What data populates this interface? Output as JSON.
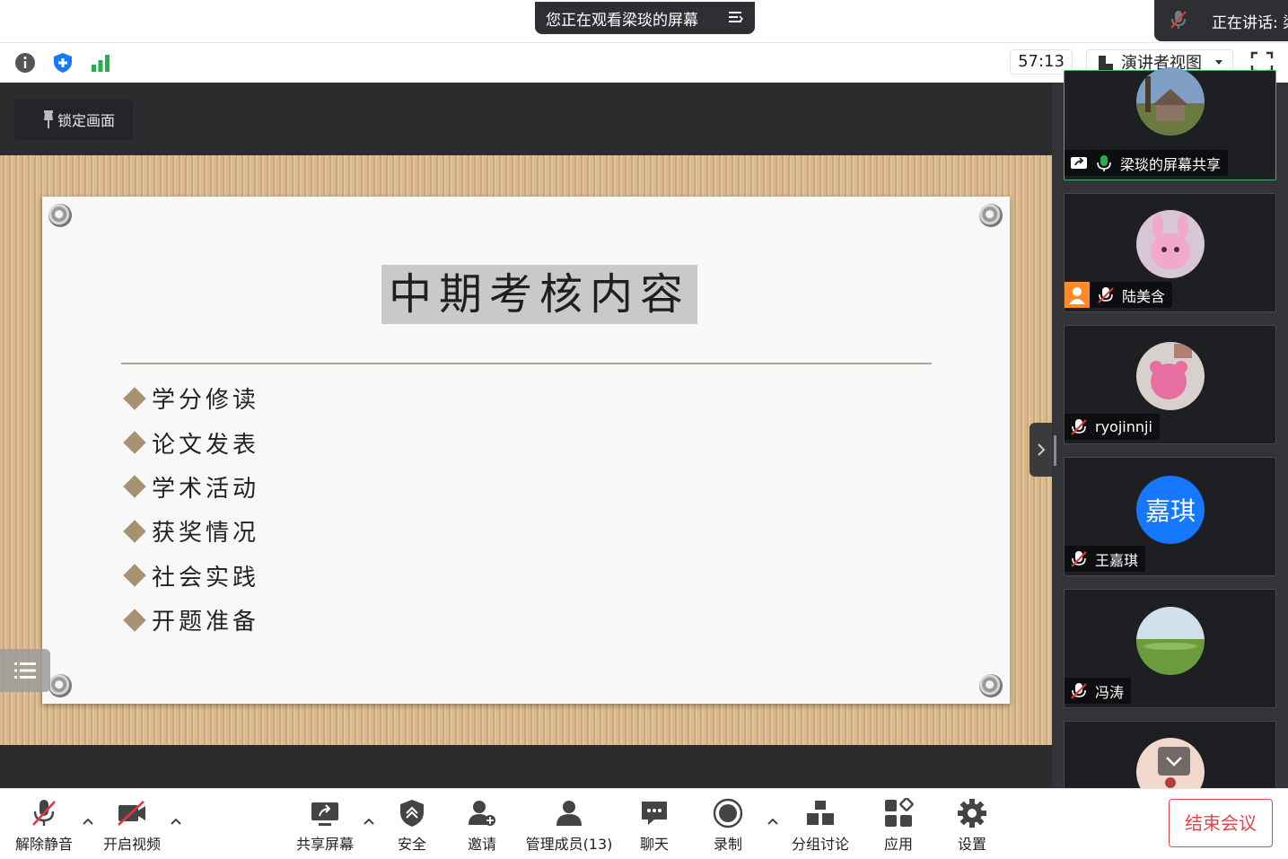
{
  "banner": {
    "watching_text": "您正在观看梁琰的屏幕",
    "speaking_text": "正在讲话: 梁"
  },
  "status": {
    "timer": "57:13",
    "view_label": "演讲者视图"
  },
  "stage": {
    "lock_label": "锁定画面",
    "slide": {
      "title": "中期考核内容",
      "bullets": [
        "学分修读",
        "论文发表",
        "学术活动",
        "获奖情况",
        "社会实践",
        "开题准备"
      ]
    }
  },
  "participants": [
    {
      "name": "梁琰的屏幕共享",
      "avatar": "house-photo",
      "status_icon": "mic-active-icon",
      "active": true
    },
    {
      "name": "陆美含",
      "avatar": "pink-bunny",
      "status_icon": "mic-muted-icon"
    },
    {
      "name": "ryojinnji",
      "avatar": "pink-bear",
      "status_icon": "mic-muted-icon"
    },
    {
      "name": "王嘉琪",
      "avatar_text": "嘉琪",
      "avatar_color": "#1677ff",
      "status_icon": "mic-muted-icon"
    },
    {
      "name": "冯涛",
      "avatar": "field-photo",
      "status_icon": "mic-muted-icon"
    }
  ],
  "toolbar": {
    "unmute": "解除静音",
    "start_video": "开启视频",
    "share_screen": "共享屏幕",
    "security": "安全",
    "invite": "邀请",
    "members": "管理成员(13)",
    "chat": "聊天",
    "record": "录制",
    "breakout": "分组讨论",
    "apps": "应用",
    "settings": "设置",
    "end_meeting": "结束会议"
  },
  "colors": {
    "accent_blue": "#1677ff",
    "mute_red": "#e0383e",
    "end_red": "#e04848",
    "active_green": "#3fb36a",
    "signal_green": "#22b14c"
  }
}
